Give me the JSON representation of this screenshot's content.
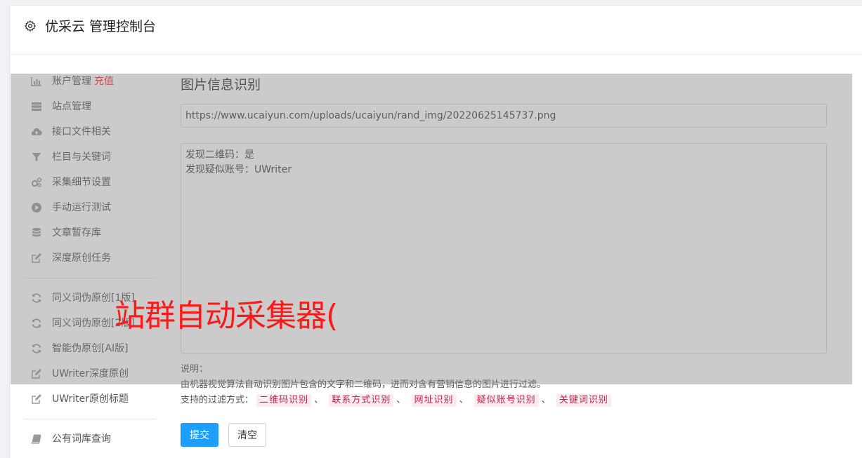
{
  "header": {
    "title": "优采云 管理控制台",
    "icon": "gear-icon"
  },
  "sidebar": {
    "items": [
      {
        "label": "账户管理",
        "extra": "充值",
        "icon": "bar-chart-icon"
      },
      {
        "label": "站点管理",
        "icon": "server-icon"
      },
      {
        "label": "接口文件相关",
        "icon": "cloud-upload-icon"
      },
      {
        "label": "栏目与关键词",
        "icon": "filter-icon"
      },
      {
        "label": "采集细节设置",
        "icon": "gears-icon"
      },
      {
        "label": "手动运行测试",
        "icon": "play-circle-icon"
      },
      {
        "label": "文章暂存库",
        "icon": "database-icon"
      },
      {
        "label": "深度原创任务",
        "icon": "edit-icon"
      },
      {
        "label": "同义词伪原创[1版]",
        "icon": "refresh-icon"
      },
      {
        "label": "同义词伪原创[2版]",
        "icon": "refresh-icon"
      },
      {
        "label": "智能伪原创[AI版]",
        "icon": "refresh-icon"
      },
      {
        "label": "UWriter深度原创",
        "icon": "edit-icon"
      },
      {
        "label": "UWriter原创标题",
        "icon": "edit-icon"
      },
      {
        "label": "公有词库查询",
        "icon": "book-icon"
      }
    ]
  },
  "main": {
    "title": "图片信息识别",
    "url_value": "https://www.ucaiyun.com/uploads/ucaiyun/rand_img/20220625145737.png",
    "result_text": "发现二维码：是\n发现疑似账号：UWriter",
    "desc_label": "说明：",
    "desc_text": "由机器视觉算法自动识别图片包含的文字和二维码，进而对含有营销信息的图片进行过滤。",
    "filters_label": "支持的过滤方式：",
    "filters": [
      "二维码识别",
      "联系方式识别",
      "网址识别",
      "疑似账号识别",
      "关键词识别"
    ],
    "filter_sep": "、",
    "submit_label": "提交",
    "clear_label": "清空"
  },
  "watermark": "站群自动采集器(",
  "colors": {
    "primary": "#1e9fff",
    "tag_text": "#c7254e",
    "tag_bg": "#fdecef",
    "watermark": "#ff1a1a",
    "accent_red": "#e53935"
  }
}
